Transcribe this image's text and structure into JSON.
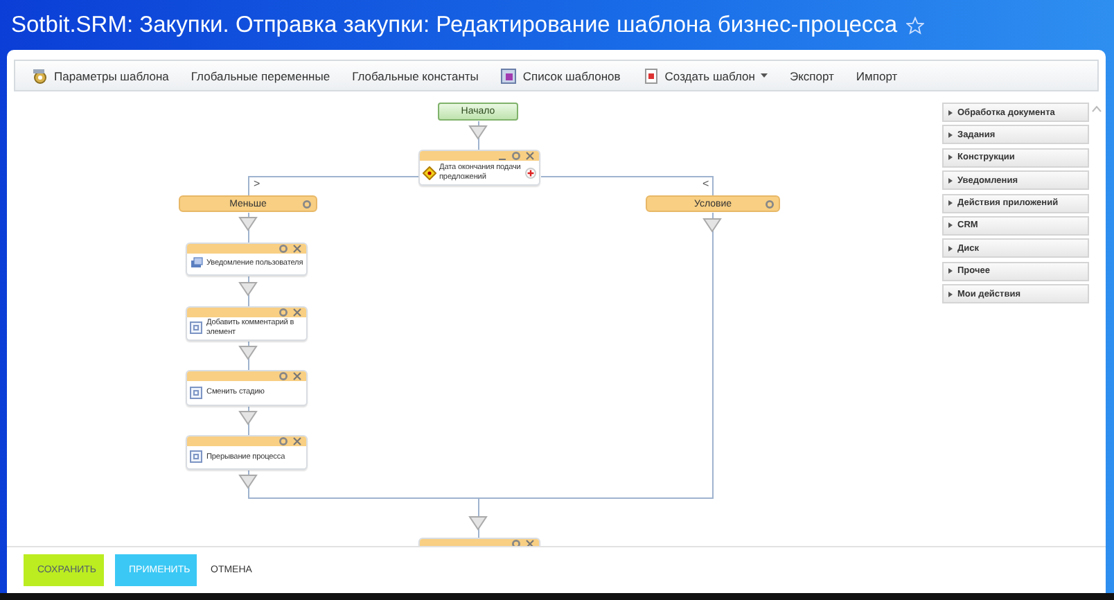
{
  "window": {
    "title": "Sotbit.SRM: Закупки. Отправка закупки: Редактирование шаблона бизнес-процесса"
  },
  "toolbar": [
    {
      "label": "Параметры шаблона"
    },
    {
      "label": "Глобальные переменные"
    },
    {
      "label": "Глобальные константы"
    },
    {
      "label": "Список шаблонов"
    },
    {
      "label": "Создать шаблон"
    },
    {
      "label": "Экспорт"
    },
    {
      "label": "Импорт"
    }
  ],
  "diagram": {
    "nodes": [
      {
        "kind": "start",
        "text": "Начало"
      },
      {
        "kind": "condition",
        "text": "Дата окончания подачи предложений"
      },
      {
        "kind": "branch",
        "text": "Меньше"
      },
      {
        "kind": "branch",
        "text": "Условие"
      },
      {
        "kind": "activity",
        "text": "Уведомление пользователя"
      },
      {
        "kind": "activity",
        "text": "Добавить комментарий в элемент"
      },
      {
        "kind": "activity",
        "text": "Сменить стадию"
      },
      {
        "kind": "activity",
        "text": "Прерывание процесса"
      },
      {
        "kind": "activity"
      }
    ],
    "branch_marks": [
      ">",
      "<"
    ]
  },
  "palette": [
    {
      "label": "Обработка документа",
      "expanded": false
    },
    {
      "label": "Задания",
      "expanded": false
    },
    {
      "label": "Конструкции",
      "expanded": false
    },
    {
      "label": "Уведомления",
      "expanded": false
    },
    {
      "label": "Действия приложений",
      "expanded": false
    },
    {
      "label": "CRM",
      "expanded": false
    },
    {
      "label": "Диск",
      "expanded": false
    },
    {
      "label": "Прочее",
      "expanded": false
    },
    {
      "label": "Мои действия",
      "expanded": false
    }
  ],
  "buttons": [
    {
      "label": "СОХРАНИТЬ",
      "kind": "primary"
    },
    {
      "label": "ПРИМЕНИТЬ",
      "kind": "secondary"
    },
    {
      "label": "ОТМЕНА",
      "kind": "link"
    }
  ]
}
